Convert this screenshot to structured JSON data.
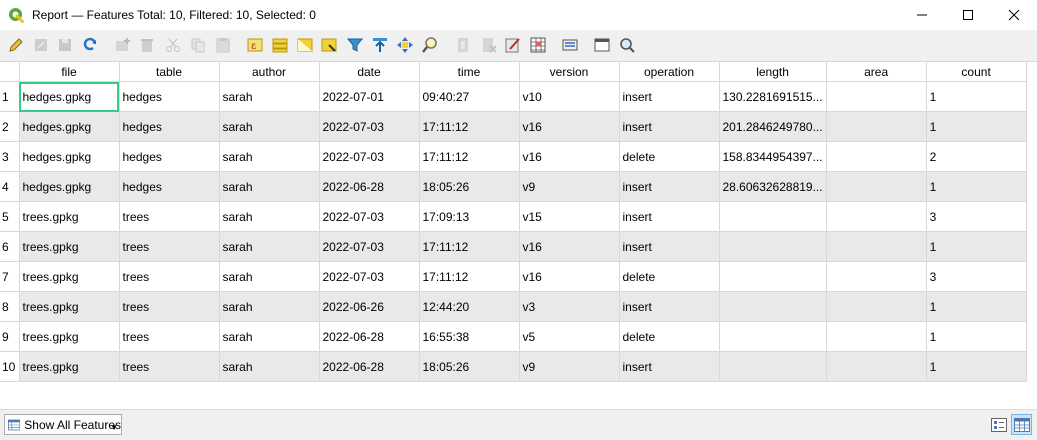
{
  "window": {
    "title": "Report — Features Total: 10, Filtered: 10, Selected: 0"
  },
  "toolbar": {
    "buttons": [
      {
        "icon": "pencil-icon",
        "enabled": true
      },
      {
        "icon": "save-edits-icon",
        "enabled": false
      },
      {
        "icon": "save-icon",
        "enabled": false
      },
      {
        "icon": "reload-icon",
        "enabled": true
      },
      {
        "icon": "add-feature-icon",
        "enabled": false
      },
      {
        "icon": "delete-feature-icon",
        "enabled": false
      },
      {
        "icon": "cut-icon",
        "enabled": false
      },
      {
        "icon": "copy-icon",
        "enabled": false
      },
      {
        "icon": "paste-icon",
        "enabled": false
      },
      {
        "icon": "select-expression-icon",
        "enabled": true
      },
      {
        "icon": "select-all-icon",
        "enabled": true
      },
      {
        "icon": "invert-selection-icon",
        "enabled": true
      },
      {
        "icon": "deselect-icon",
        "enabled": true
      },
      {
        "icon": "filter-icon",
        "enabled": true
      },
      {
        "icon": "move-to-top-icon",
        "enabled": true
      },
      {
        "icon": "pan-to-selection-icon",
        "enabled": true
      },
      {
        "icon": "zoom-to-selection-icon",
        "enabled": true
      },
      {
        "icon": "new-field-icon",
        "enabled": false
      },
      {
        "icon": "delete-field-icon",
        "enabled": false
      },
      {
        "icon": "field-calculator-icon",
        "enabled": true
      },
      {
        "icon": "conditional-formatting-icon",
        "enabled": true
      },
      {
        "icon": "actions-icon",
        "enabled": true
      },
      {
        "icon": "dock-icon",
        "enabled": true
      },
      {
        "icon": "search-icon",
        "enabled": true
      }
    ]
  },
  "table": {
    "columns": [
      "file",
      "table",
      "author",
      "date",
      "time",
      "version",
      "operation",
      "length",
      "area",
      "count"
    ],
    "rows": [
      {
        "n": "1",
        "cells": [
          "hedges.gpkg",
          "hedges",
          "sarah",
          "2022-07-01",
          "09:40:27",
          "v10",
          "insert",
          "130.2281691515...",
          "",
          "1"
        ]
      },
      {
        "n": "2",
        "cells": [
          "hedges.gpkg",
          "hedges",
          "sarah",
          "2022-07-03",
          "17:11:12",
          "v16",
          "insert",
          "201.2846249780...",
          "",
          "1"
        ]
      },
      {
        "n": "3",
        "cells": [
          "hedges.gpkg",
          "hedges",
          "sarah",
          "2022-07-03",
          "17:11:12",
          "v16",
          "delete",
          "158.8344954397...",
          "",
          "2"
        ]
      },
      {
        "n": "4",
        "cells": [
          "hedges.gpkg",
          "hedges",
          "sarah",
          "2022-06-28",
          "18:05:26",
          "v9",
          "insert",
          "28.60632628819...",
          "",
          "1"
        ]
      },
      {
        "n": "5",
        "cells": [
          "trees.gpkg",
          "trees",
          "sarah",
          "2022-07-03",
          "17:09:13",
          "v15",
          "insert",
          "",
          "",
          "3"
        ]
      },
      {
        "n": "6",
        "cells": [
          "trees.gpkg",
          "trees",
          "sarah",
          "2022-07-03",
          "17:11:12",
          "v16",
          "insert",
          "",
          "",
          "1"
        ]
      },
      {
        "n": "7",
        "cells": [
          "trees.gpkg",
          "trees",
          "sarah",
          "2022-07-03",
          "17:11:12",
          "v16",
          "delete",
          "",
          "",
          "3"
        ]
      },
      {
        "n": "8",
        "cells": [
          "trees.gpkg",
          "trees",
          "sarah",
          "2022-06-26",
          "12:44:20",
          "v3",
          "insert",
          "",
          "",
          "1"
        ]
      },
      {
        "n": "9",
        "cells": [
          "trees.gpkg",
          "trees",
          "sarah",
          "2022-06-28",
          "16:55:38",
          "v5",
          "delete",
          "",
          "",
          "1"
        ]
      },
      {
        "n": "10",
        "cells": [
          "trees.gpkg",
          "trees",
          "sarah",
          "2022-06-28",
          "18:05:26",
          "v9",
          "insert",
          "",
          "",
          "1"
        ]
      }
    ],
    "selected_cell": {
      "row": 0,
      "col": 0
    }
  },
  "footer": {
    "filter_label": "Show All Features"
  },
  "colors": {
    "selection_outline": "#33cc88",
    "alt_row": "#e9e9e9",
    "logo_green": "#5aa83c"
  }
}
